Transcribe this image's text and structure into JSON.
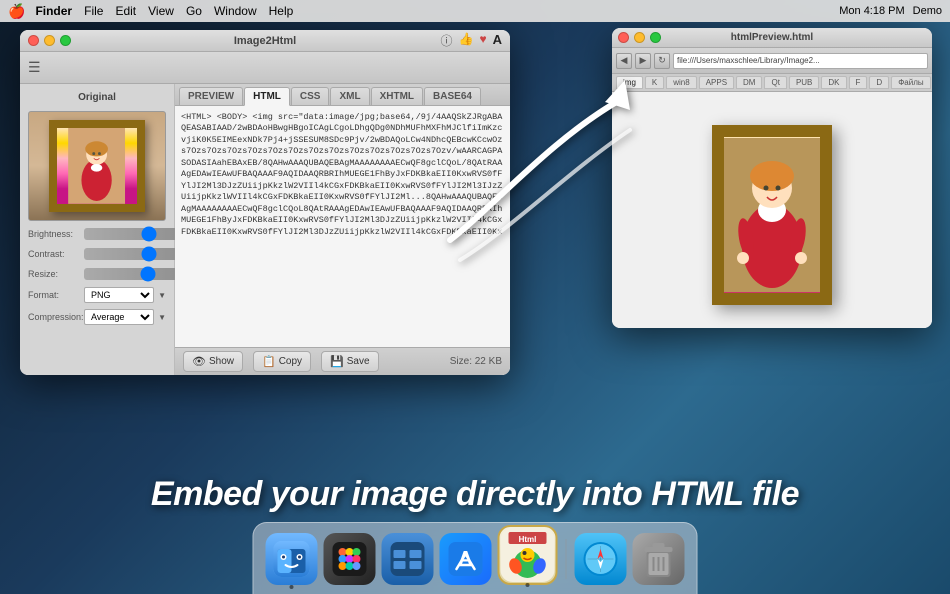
{
  "menubar": {
    "apple": "🍎",
    "items": [
      "Finder",
      "File",
      "Edit",
      "View",
      "Go",
      "Window",
      "Help"
    ],
    "right": {
      "time": "Mon 4:18 PM",
      "user": "Demo"
    }
  },
  "mainWindow": {
    "title": "Image2Html",
    "toolbar": {
      "hamburgerIcon": "☰",
      "infoIcon": "ⓘ",
      "thumbsUpIcon": "👍",
      "heartIcon": "♥",
      "textIcon": "A"
    },
    "leftPanel": {
      "label": "Original",
      "sliders": [
        {
          "label": "Brightness:",
          "value": "0"
        },
        {
          "label": "Contrast:",
          "value": "0"
        },
        {
          "label": "Resize:",
          "value": "100"
        }
      ],
      "format": {
        "label": "Format:",
        "value": "PNG"
      },
      "compression": {
        "label": "Compression:",
        "value": "Average"
      }
    },
    "tabs": [
      "PREVIEW",
      "HTML",
      "CSS",
      "XML",
      "XHTML",
      "BASE64"
    ],
    "activeTab": "HTML",
    "codeContent": "<HTML> <BODY> <img src=\"data:image/jpg;base64,/9j/4AAQSkZJRgABAQEASABIAAD/2wBDAoHBwgHBgoICAgLCgoLDhgQDg0NDhMUFhMXFhMJClfiImKzcvjiK0K5EIMEexNDk7Pj4+jSSESUM8SDc9Pjv/2wBDAQoLCw4NDhcQEBcwKCcwOzs7Ozs7Ozs7Ozs7Ozs7Ozs7Ozs7Ozs7Ozs7Ozs7Ozs7Ozs7Ozs7Ozv/wAARCAGPASODASIAahEBAxEB/8QAHwAAAQUBAQEBAgMAAAAAAAAECwQF8gclCQoL/8QAtRAAAgEDAwIEAwUFBAQAAAF9AQIDAAQRBRIhMUEGE1FhByJxFDKBkaEII0KxwRVS0eFlJI0OXk5mq2JGfBrVS50TVW...",
    "bottomBar": {
      "showLabel": "Show",
      "copyLabel": "Copy",
      "saveLabel": "Save",
      "sizeLabel": "Size: 22 KB"
    }
  },
  "browserWindow": {
    "title": "htmlPreview.html",
    "address": "file:///Users/maxschlee/Library/Image2...",
    "tabs": [
      "img",
      "K",
      "win8",
      "APPS",
      "DM",
      "Qt",
      "PUB",
      "DK",
      "F",
      "D",
      "Файлы"
    ]
  },
  "bigText": "Embed your image directly into HTML file",
  "dock": {
    "icons": [
      {
        "name": "finder",
        "emoji": "🔵",
        "label": "Finder",
        "active": true
      },
      {
        "name": "launchpad",
        "label": "Launchpad"
      },
      {
        "name": "mission-control",
        "label": "Mission Control"
      },
      {
        "name": "app-store",
        "label": "App Store"
      },
      {
        "name": "image2html",
        "label": "Image2Html",
        "active": true
      },
      {
        "name": "safari",
        "label": "Safari"
      },
      {
        "name": "trash",
        "label": "Trash"
      }
    ]
  }
}
